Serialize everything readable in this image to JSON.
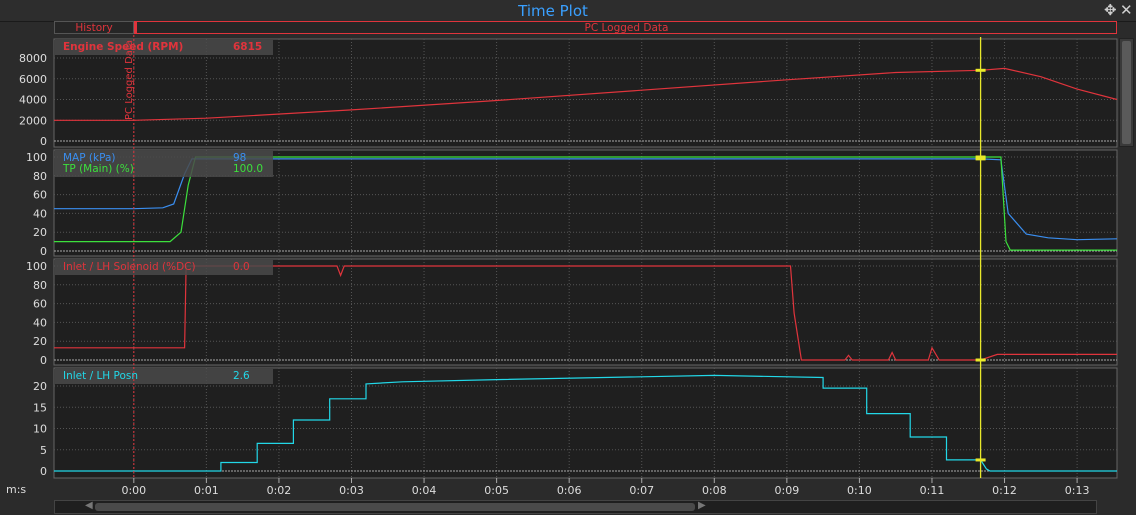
{
  "window": {
    "title": "Time Plot",
    "move_icon": "move-icon",
    "close_icon": "close-icon"
  },
  "tabs": {
    "history": "History",
    "pc_logged": "PC Logged Data"
  },
  "colors": {
    "red": "#e0343c",
    "blue": "#3a8ef0",
    "green": "#3ce03c",
    "cyan": "#22d8e8",
    "cursor": "#e8e82a",
    "marker": "#e0343c"
  },
  "time_unit_label": "m:s",
  "marker_label": "PC Logged Data",
  "chart_data": {
    "type": "line",
    "x_unit": "s",
    "xlim": [
      -1.1,
      13.55
    ],
    "x_ticks": [
      0,
      1,
      2,
      3,
      4,
      5,
      6,
      7,
      8,
      9,
      10,
      11,
      12,
      13
    ],
    "x_tick_labels": [
      "0:00",
      "0:01",
      "0:02",
      "0:03",
      "0:04",
      "0:05",
      "0:06",
      "0:07",
      "0:08",
      "0:09",
      "0:10",
      "0:11",
      "0:12",
      "0:13"
    ],
    "marker_x": 0,
    "cursor_x": 11.67,
    "grid": true,
    "panels": [
      {
        "ylim": [
          0,
          9000
        ],
        "y_ticks": [
          0,
          2000,
          4000,
          6000,
          8000
        ],
        "series": [
          {
            "name": "Engine Speed (RPM)",
            "readout": "6815",
            "color": "#e0343c",
            "points": [
              [
                -1.1,
                2000
              ],
              [
                0,
                2000
              ],
              [
                1,
                2200
              ],
              [
                3,
                3000
              ],
              [
                5,
                3900
              ],
              [
                7,
                4900
              ],
              [
                9,
                5900
              ],
              [
                10.5,
                6600
              ],
              [
                11.67,
                6815
              ],
              [
                12,
                7000
              ],
              [
                12.5,
                6200
              ],
              [
                13,
                5000
              ],
              [
                13.55,
                4000
              ]
            ]
          }
        ]
      },
      {
        "ylim": [
          0,
          105
        ],
        "y_ticks": [
          0,
          20,
          40,
          60,
          80,
          100
        ],
        "series": [
          {
            "name": "MAP (kPa)",
            "readout": "98",
            "color": "#3a8ef0",
            "points": [
              [
                -1.1,
                45
              ],
              [
                0,
                45
              ],
              [
                0.4,
                46
              ],
              [
                0.55,
                50
              ],
              [
                0.7,
                82
              ],
              [
                0.8,
                98
              ],
              [
                6,
                98
              ],
              [
                9,
                98
              ],
              [
                11.67,
                98
              ],
              [
                11.95,
                97
              ],
              [
                12.05,
                40
              ],
              [
                12.3,
                18
              ],
              [
                12.6,
                14
              ],
              [
                13,
                12
              ],
              [
                13.55,
                13
              ]
            ]
          },
          {
            "name": "TP (Main) (%)",
            "readout": "100.0",
            "color": "#3ce03c",
            "points": [
              [
                -1.1,
                10
              ],
              [
                0,
                10
              ],
              [
                0.5,
                10
              ],
              [
                0.65,
                20
              ],
              [
                0.75,
                70
              ],
              [
                0.85,
                100
              ],
              [
                11.67,
                100
              ],
              [
                11.95,
                100
              ],
              [
                12.02,
                10
              ],
              [
                12.08,
                1
              ],
              [
                13.55,
                1
              ]
            ]
          }
        ]
      },
      {
        "ylim": [
          0,
          105
        ],
        "y_ticks": [
          0,
          20,
          40,
          60,
          80,
          100
        ],
        "series": [
          {
            "name": "Inlet / LH Solenoid (%DC)",
            "readout": "0.0",
            "color": "#e0343c",
            "points": [
              [
                -1.1,
                13
              ],
              [
                0.7,
                13
              ],
              [
                0.72,
                100
              ],
              [
                2.8,
                100
              ],
              [
                2.85,
                90
              ],
              [
                2.9,
                100
              ],
              [
                5,
                100
              ],
              [
                9.05,
                100
              ],
              [
                9.1,
                50
              ],
              [
                9.2,
                0
              ],
              [
                9.8,
                0
              ],
              [
                9.85,
                5
              ],
              [
                9.9,
                0
              ],
              [
                10.4,
                0
              ],
              [
                10.45,
                8
              ],
              [
                10.5,
                0
              ],
              [
                10.95,
                0
              ],
              [
                11,
                13
              ],
              [
                11.1,
                0
              ],
              [
                11.67,
                0
              ],
              [
                11.9,
                6
              ],
              [
                13.55,
                6
              ]
            ]
          }
        ]
      },
      {
        "ylim": [
          0,
          24
        ],
        "y_ticks": [
          0,
          5,
          10,
          15,
          20
        ],
        "series": [
          {
            "name": "Inlet / LH Posn",
            "readout": "2.6",
            "color": "#22d8e8",
            "points": [
              [
                -1.1,
                0
              ],
              [
                1.2,
                0
              ],
              [
                1.2,
                2
              ],
              [
                1.7,
                2
              ],
              [
                1.7,
                6.5
              ],
              [
                2.2,
                6.5
              ],
              [
                2.2,
                12
              ],
              [
                2.7,
                12
              ],
              [
                2.7,
                17
              ],
              [
                3.2,
                17
              ],
              [
                3.2,
                20.5
              ],
              [
                3.7,
                21
              ],
              [
                5,
                21.5
              ],
              [
                8,
                22.5
              ],
              [
                9.5,
                22
              ],
              [
                9.5,
                19.5
              ],
              [
                10.1,
                19.5
              ],
              [
                10.1,
                13.5
              ],
              [
                10.7,
                13.5
              ],
              [
                10.7,
                8
              ],
              [
                11.2,
                8
              ],
              [
                11.2,
                2.6
              ],
              [
                11.67,
                2.6
              ],
              [
                11.75,
                0.5
              ],
              [
                11.8,
                0
              ],
              [
                13.55,
                0
              ]
            ]
          }
        ]
      }
    ]
  }
}
